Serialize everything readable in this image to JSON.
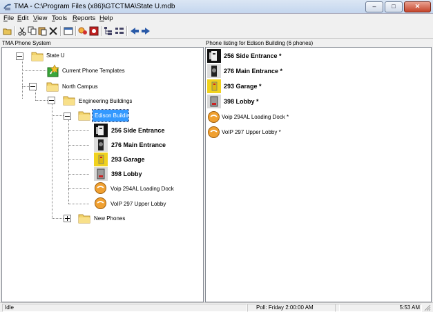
{
  "window": {
    "title": "TMA - C:\\Program Files (x86)\\GTCTMA\\State U.mdb",
    "minimize": "–",
    "maximize": "□",
    "close": "✕"
  },
  "menu": [
    {
      "label": "File",
      "key": "F",
      "rest": "ile"
    },
    {
      "label": "Edit",
      "key": "E",
      "rest": "dit"
    },
    {
      "label": "View",
      "key": "V",
      "rest": "iew"
    },
    {
      "label": "Tools",
      "key": "T",
      "rest": "ools"
    },
    {
      "label": "Reports",
      "key": "R",
      "rest": "eports"
    },
    {
      "label": "Help",
      "key": "H",
      "rest": "elp"
    }
  ],
  "toolbar": {
    "buttons": [
      "open-icon",
      "cut-icon",
      "copy-icon",
      "paste-icon",
      "delete-icon",
      "properties-icon",
      "find-icon",
      "phone-config-icon",
      "tree-view-icon",
      "list-view-icon",
      "back-icon",
      "forward-icon"
    ]
  },
  "left_pane": {
    "header": "TMA Phone System",
    "tree": {
      "root": "State U",
      "templates": "Current Phone Templates",
      "campus": "North Campus",
      "group": "Engineering Buildings",
      "building": "Edison Building",
      "phones": [
        {
          "label": "256 Side Entrance",
          "bold": true,
          "icon": "wall-phone-icon"
        },
        {
          "label": "276 Main Entrance",
          "bold": true,
          "icon": "entrance-phone-icon"
        },
        {
          "label": "293 Garage",
          "bold": true,
          "icon": "garage-phone-icon"
        },
        {
          "label": "398 Lobby",
          "bold": true,
          "icon": "lobby-phone-icon"
        },
        {
          "label": "Voip 294AL Loading Dock",
          "bold": false,
          "icon": "voip-icon"
        },
        {
          "label": "VoIP 297 Upper Lobby",
          "bold": false,
          "icon": "voip-icon"
        }
      ],
      "new_phones": "New Phones"
    }
  },
  "right_pane": {
    "header": "Phone listing for Edison Building (6 phones)",
    "phones": [
      {
        "label": "256 Side Entrance *",
        "bold": true
      },
      {
        "label": "276 Main Entrance *",
        "bold": true
      },
      {
        "label": "293 Garage *",
        "bold": true
      },
      {
        "label": "398 Lobby *",
        "bold": true
      },
      {
        "label": "Voip 294AL Loading Dock *",
        "bold": false
      },
      {
        "label": "VoIP 297 Upper Lobby *",
        "bold": false
      }
    ]
  },
  "status": {
    "state": "Idle",
    "poll": "Poll:  Friday 2:00:00 AM",
    "time": "5:53 AM"
  },
  "colors": {
    "selection": "#3399ff",
    "folder": "#f2d36b",
    "voip": "#f0a030"
  }
}
